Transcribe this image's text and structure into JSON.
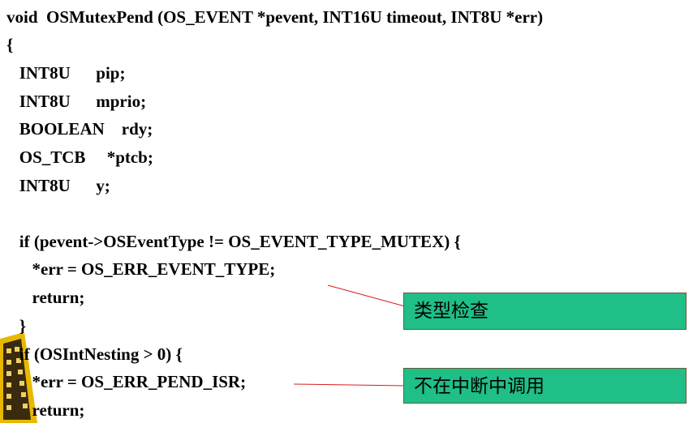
{
  "code_lines": [
    "void  OSMutexPend (OS_EVENT *pevent, INT16U timeout, INT8U *err)",
    "{",
    "   INT8U      pip;",
    "   INT8U      mprio;",
    "   BOOLEAN    rdy;",
    "   OS_TCB     *ptcb;",
    "   INT8U      y;",
    "",
    "   if (pevent->OSEventType != OS_EVENT_TYPE_MUTEX) {",
    "      *err = OS_ERR_EVENT_TYPE;",
    "      return;",
    "   }",
    "   if (OSIntNesting > 0) {",
    "      *err = OS_ERR_PEND_ISR;",
    "      return;"
  ],
  "callouts": [
    {
      "text": "类型检查"
    },
    {
      "text": "不在中断中调用"
    }
  ],
  "colors": {
    "callout_fill": "#1fbf87",
    "callout_border": "#6a5a3a",
    "leader_line": "#d42020",
    "decoration": "#e8b800"
  },
  "decoration_icon": "film-strip-decoration"
}
